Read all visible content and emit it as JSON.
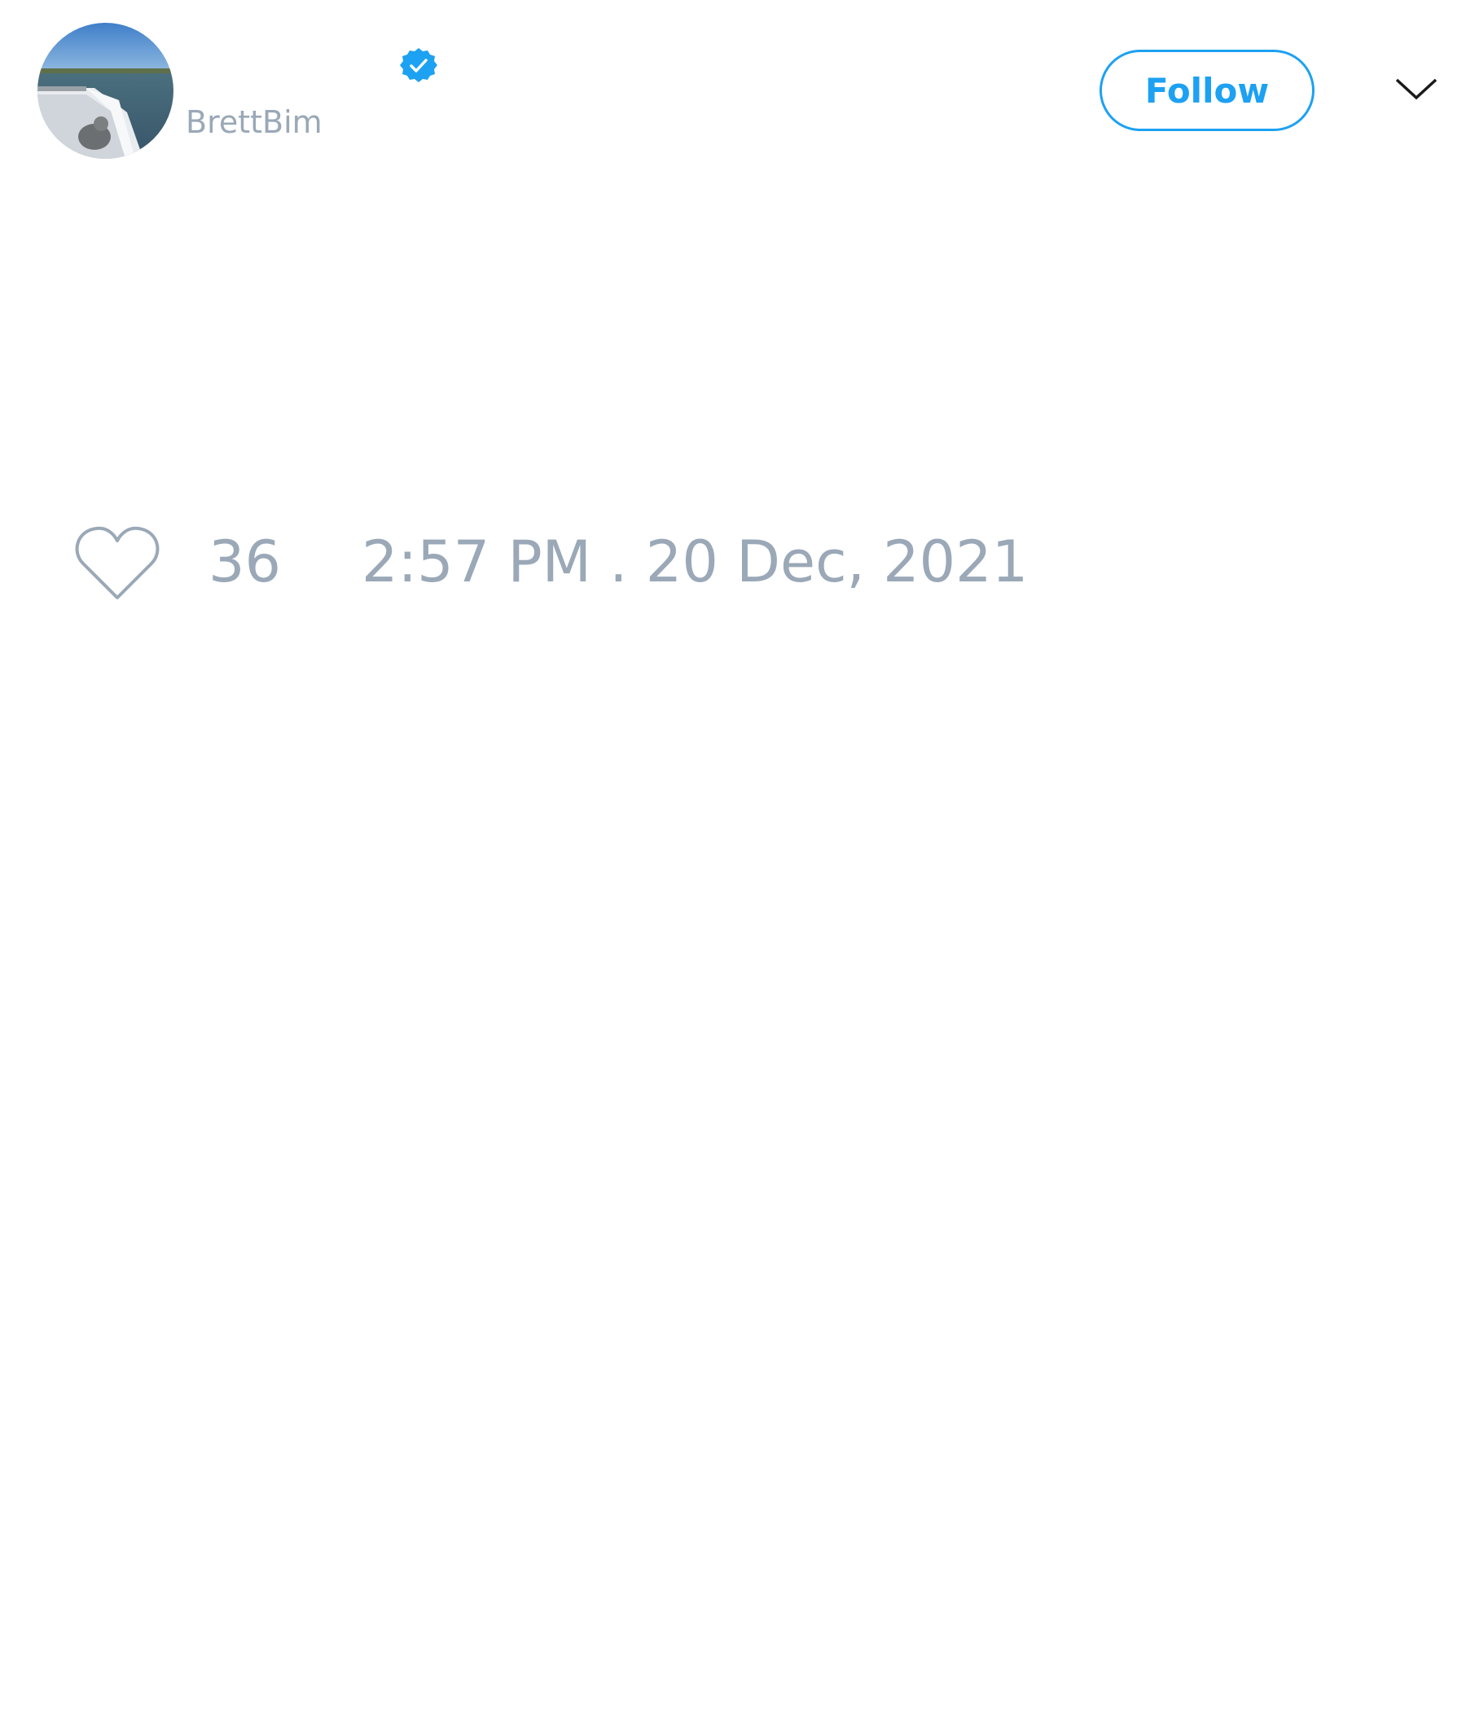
{
  "tweet": {
    "author": {
      "handle": "BrettBim",
      "verified": true
    },
    "follow_label": "Follow",
    "menu_icon": "chevron-down-icon",
    "likes": "36",
    "timestamp": "2:57 PM . 20 Dec, 2021"
  },
  "colors": {
    "accent": "#1da1f2",
    "muted_text": "#9aa8b7",
    "background": "#ffffff"
  }
}
